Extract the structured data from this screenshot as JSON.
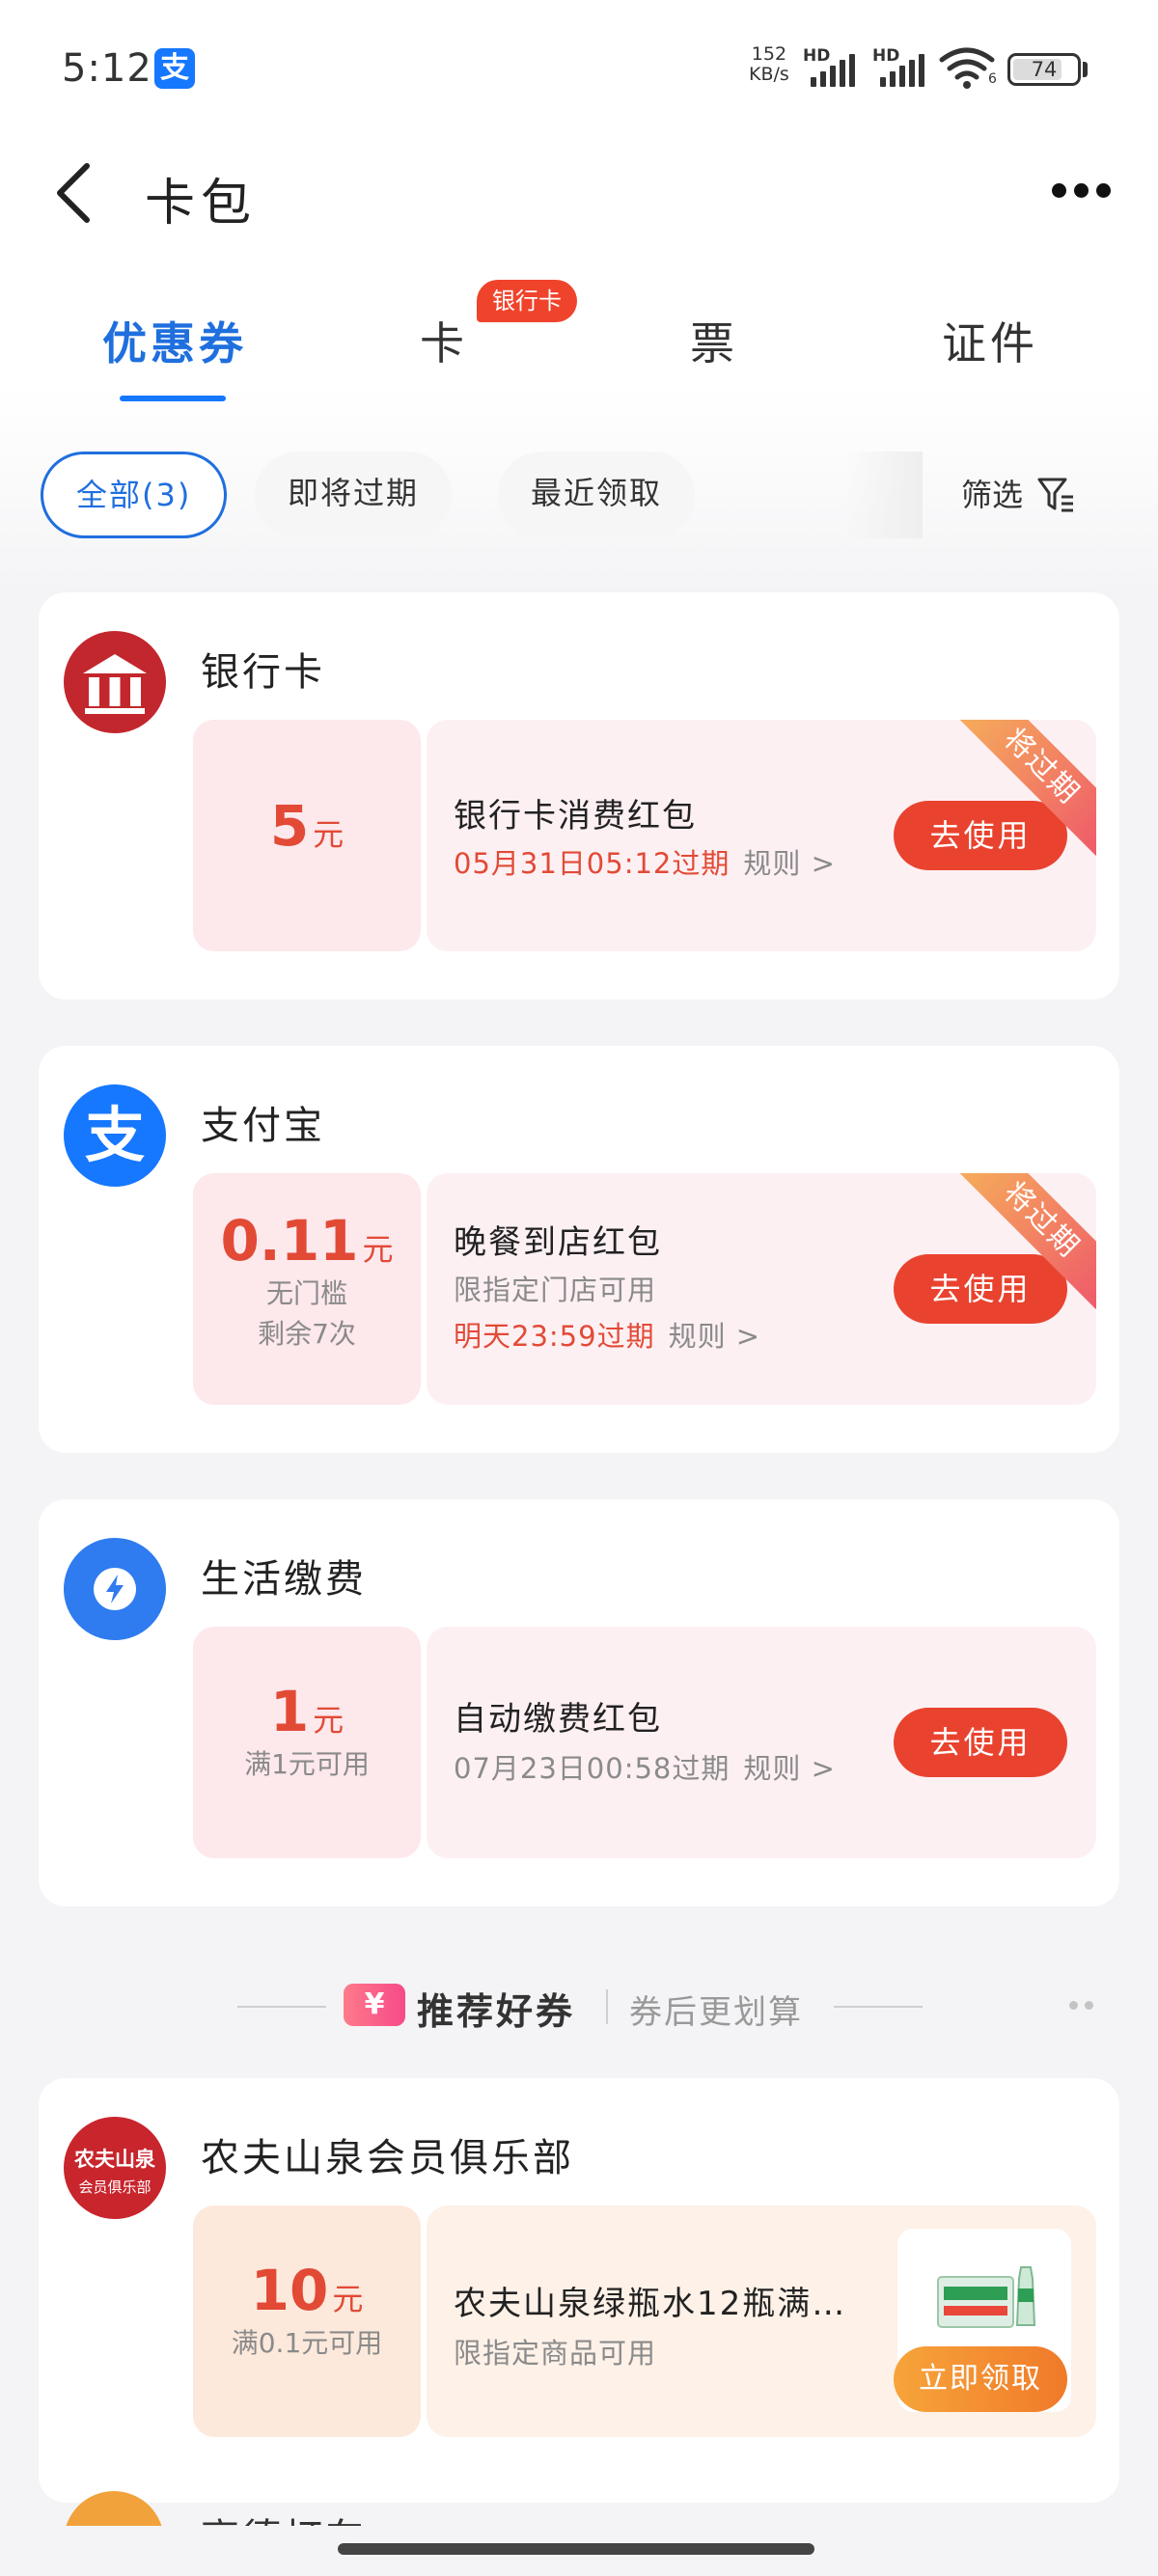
{
  "status_bar": {
    "time": "5:12",
    "app_badge": "支",
    "net_speed_value": "152",
    "net_speed_unit": "KB/s",
    "signal_label": "HD",
    "wifi_index": "6",
    "battery": "74"
  },
  "header": {
    "title": "卡包"
  },
  "tabs": [
    {
      "label": "优惠券",
      "active": true
    },
    {
      "label": "卡",
      "badge": "银行卡"
    },
    {
      "label": "票"
    },
    {
      "label": "证件"
    }
  ],
  "filters": {
    "chips": [
      "全部(3)",
      "即将过期",
      "最近领取"
    ],
    "filter_label": "筛选"
  },
  "sections": [
    {
      "brand": "银行卡",
      "coupon": {
        "amount": "5",
        "unit": "元",
        "title": "银行卡消费红包",
        "expire": "05月31日05:12过期",
        "rule": "规则",
        "button": "去使用",
        "ribbon": "将过期"
      }
    },
    {
      "brand": "支付宝",
      "brand_icon": "支",
      "coupon": {
        "amount": "0.11",
        "unit": "元",
        "cond1": "无门槛",
        "cond2": "剩余7次",
        "title": "晚餐到店红包",
        "sub": "限指定门店可用",
        "expire": "明天23:59过期",
        "rule": "规则",
        "button": "去使用",
        "ribbon": "将过期"
      }
    },
    {
      "brand": "生活缴费",
      "coupon": {
        "amount": "1",
        "unit": "元",
        "cond1": "满1元可用",
        "title": "自动缴费红包",
        "expire": "07月23日00:58过期",
        "rule": "规则",
        "button": "去使用"
      }
    }
  ],
  "recommend": {
    "icon": "¥",
    "title": "推荐好券",
    "subtitle": "券后更划算"
  },
  "recommend_section": {
    "brand": "农夫山泉会员俱乐部",
    "logo_line1": "农夫山泉",
    "logo_line2": "会员俱乐部",
    "coupon": {
      "amount": "10",
      "unit": "元",
      "cond1": "满0.1元可用",
      "title": "农夫山泉绿瓶水12瓶满…",
      "sub": "限指定商品可用",
      "button": "立即领取"
    }
  },
  "next_section": {
    "brand": "高德打车"
  },
  "colors": {
    "primary_blue": "#1677ff",
    "accent_red": "#e9432f",
    "coupon_pink": "#fde8ec",
    "coupon_peach": "#fde9dc"
  },
  "icons": [
    "back-arrow-icon",
    "more-dots-icon",
    "filter-funnel-icon",
    "bank-icon",
    "alipay-icon",
    "lightning-icon",
    "wifi-icon",
    "battery-icon"
  ]
}
